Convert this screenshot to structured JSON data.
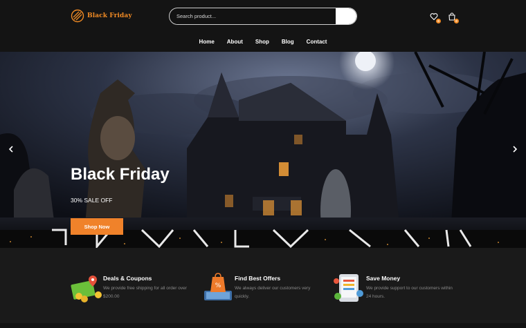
{
  "header": {
    "logo_text": "Black Friday",
    "search_placeholder": "Search product...",
    "wishlist_count": "0",
    "cart_count": "0"
  },
  "nav": [
    {
      "label": "Home"
    },
    {
      "label": "About"
    },
    {
      "label": "Shop"
    },
    {
      "label": "Blog"
    },
    {
      "label": "Contact"
    }
  ],
  "hero": {
    "title": "Black Friday",
    "subtitle": "30% SALE OFF",
    "button": "Shop Now"
  },
  "features": [
    {
      "title": "Deals & Coupons",
      "desc": "We provide free shipping for all order over $200.00",
      "icon": "coupon-icon"
    },
    {
      "title": "Find Best Offers",
      "desc": "We always deliver our customers very quickly.",
      "icon": "offers-icon"
    },
    {
      "title": "Save Money",
      "desc": "We provide support to our customers within 24 hours.",
      "icon": "save-money-icon"
    }
  ],
  "colors": {
    "accent": "#f0822a",
    "header_bg": "#141414",
    "page_bg": "#1a1a1a"
  }
}
